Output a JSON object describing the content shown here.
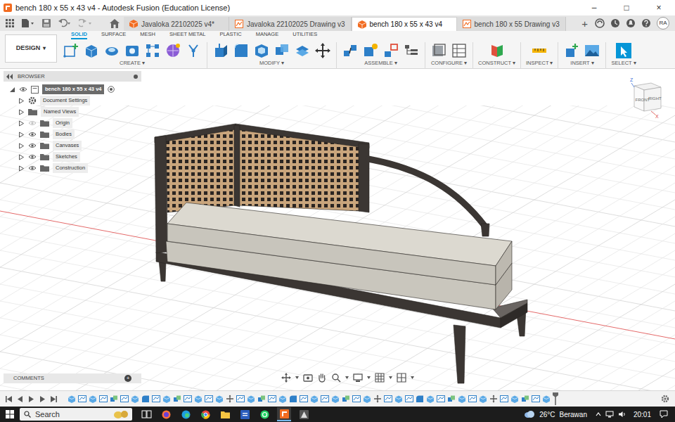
{
  "window": {
    "title": "bench 180 x 55 x 43 v4 - Autodesk Fusion (Education License)",
    "controls": [
      "–",
      "□",
      "×"
    ]
  },
  "doc_tabs": [
    {
      "label": "Javaloka 22102025 v4*",
      "kind": "design",
      "selected": false
    },
    {
      "label": "Javaloka 22102025 Drawing v3",
      "kind": "drawing",
      "selected": false
    },
    {
      "label": "bench 180 x 55 x 43 v4",
      "kind": "design",
      "selected": true
    },
    {
      "label": "bench 180 x 55 Drawing v3",
      "kind": "drawing",
      "selected": false
    }
  ],
  "new_tab": "+",
  "user": {
    "initials": "RA"
  },
  "workspace": {
    "label": "DESIGN",
    "caret": "▾"
  },
  "ribbon_tabs": [
    {
      "label": "SOLID",
      "selected": true
    },
    {
      "label": "SURFACE",
      "selected": false
    },
    {
      "label": "MESH",
      "selected": false
    },
    {
      "label": "SHEET METAL",
      "selected": false
    },
    {
      "label": "PLASTIC",
      "selected": false
    },
    {
      "label": "MANAGE",
      "selected": false
    },
    {
      "label": "UTILITIES",
      "selected": false
    }
  ],
  "ribbon_groups": [
    "CREATE ▾",
    "MODIFY ▾",
    "ASSEMBLE ▾",
    "CONFIGURE ▾",
    "CONSTRUCT ▾",
    "INSPECT ▾",
    "INSERT ▾",
    "SELECT ▾"
  ],
  "browser": {
    "title": "BROWSER",
    "root": {
      "label": "bench 180 x 55 x 43 v4",
      "expanded": true
    },
    "items": [
      {
        "label": "Document Settings",
        "kind": "settings",
        "expanded": false
      },
      {
        "label": "Named Views",
        "kind": "views",
        "expanded": false
      },
      {
        "label": "Origin",
        "kind": "folder",
        "expanded": false,
        "visible": false
      },
      {
        "label": "Bodies",
        "kind": "folder",
        "expanded": false,
        "visible": true
      },
      {
        "label": "Canvases",
        "kind": "folder",
        "expanded": false,
        "visible": true
      },
      {
        "label": "Sketches",
        "kind": "folder",
        "expanded": false,
        "visible": true
      },
      {
        "label": "Construction",
        "kind": "folder",
        "expanded": false,
        "visible": true
      }
    ]
  },
  "viewcube": {
    "front": "FRONT",
    "right": "RIGHT",
    "z": "Z",
    "x": "X"
  },
  "comments": {
    "title": "COMMENTS",
    "add": "+"
  },
  "timeline": {
    "features": [
      "extrude",
      "sketch",
      "extrude",
      "sketch",
      "combine",
      "sketch",
      "extrude",
      "fillet",
      "sketch",
      "extrude",
      "combine",
      "sketch",
      "extrude",
      "sketch",
      "extrude",
      "move",
      "sketch",
      "extrude",
      "combine",
      "sketch",
      "extrude",
      "fillet",
      "sketch",
      "extrude",
      "sketch",
      "extrude",
      "combine",
      "sketch",
      "extrude",
      "move",
      "sketch",
      "extrude",
      "sketch",
      "fillet",
      "extrude",
      "sketch",
      "combine",
      "extrude",
      "sketch",
      "extrude",
      "move",
      "sketch",
      "extrude",
      "combine",
      "sketch",
      "extrude"
    ]
  },
  "taskbar": {
    "search": "Search",
    "temperature": "26°C",
    "weather": "Berawan",
    "time": "20:01"
  }
}
